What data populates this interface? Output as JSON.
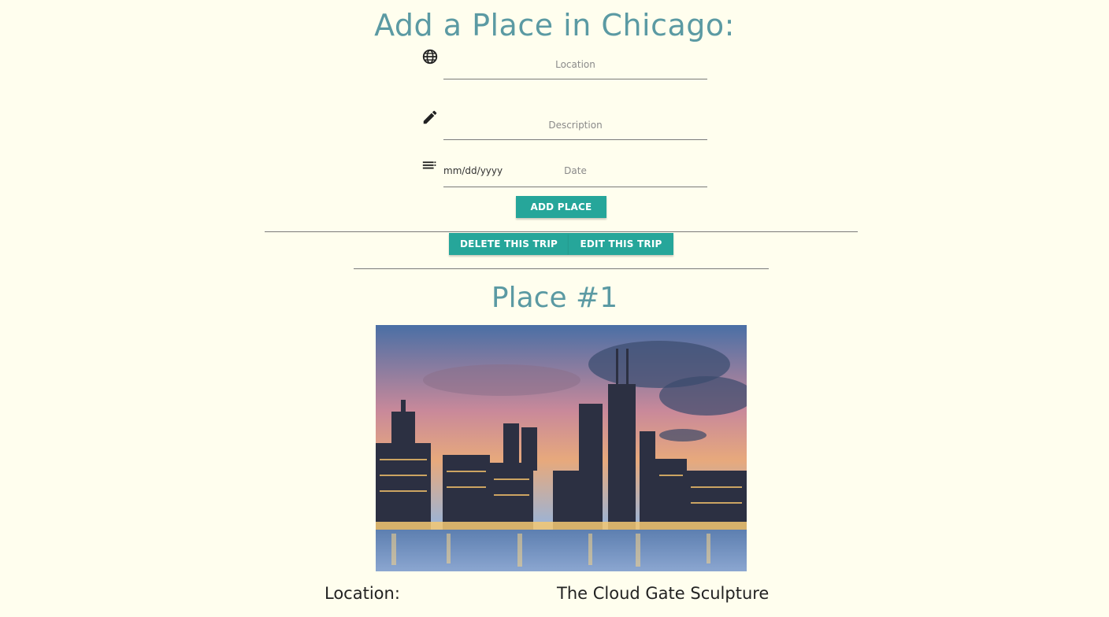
{
  "page": {
    "title": "Add a Place in Chicago:"
  },
  "form": {
    "location_placeholder": "Location",
    "description_placeholder": "Description",
    "date_value": "mm/dd/yyyy",
    "date_label": "Date",
    "add_button": "ADD PLACE",
    "icons": [
      "globe-icon",
      "pencil-icon",
      "notes-icon"
    ]
  },
  "trip_actions": {
    "delete_label": "DELETE THIS TRIP",
    "edit_label": "EDIT THIS TRIP"
  },
  "place": {
    "heading": "Place #1",
    "location_label": "Location:",
    "location_value": "The Cloud Gate Sculpture"
  },
  "colors": {
    "background": "#fffeee",
    "heading": "#5b9aa3",
    "button": "#26a69a"
  }
}
